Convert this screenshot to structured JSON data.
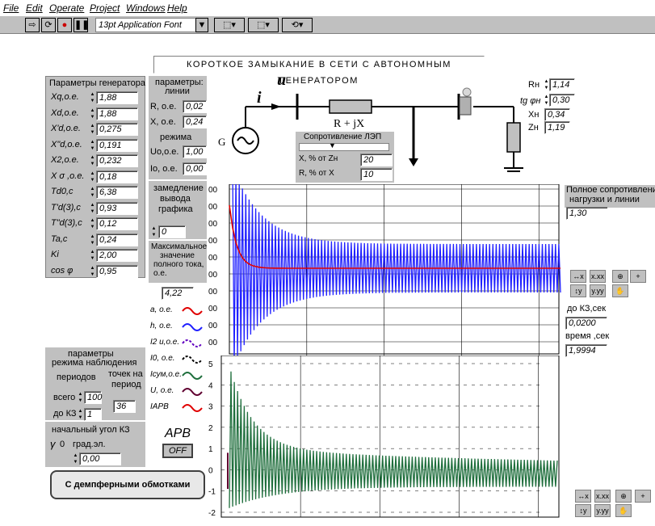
{
  "menu": [
    "File",
    "Edit",
    "Operate",
    "Project",
    "Windows",
    "Help"
  ],
  "toolbar": {
    "font": "13pt Application Font"
  },
  "title": "КОРОТКОЕ ЗАМЫКАНИЕ В СЕТИ С АВТОНОМНЫМ ГЕНЕРАТОРОМ",
  "gen": {
    "header": "Параметры генератора",
    "rows": [
      {
        "label": "Xq,о.е.",
        "value": "1,88"
      },
      {
        "label": "Xd,о.е.",
        "value": "1,88"
      },
      {
        "label": "X'd,о.е.",
        "value": "0,275"
      },
      {
        "label": "X\"d,о.е.",
        "value": "0,191"
      },
      {
        "label": "X2,о.е.",
        "value": "0,232"
      },
      {
        "label": "X σ ,о.е.",
        "value": "0,18"
      },
      {
        "label": "Td0,c",
        "value": "6,38"
      },
      {
        "label": "T'd(3),c",
        "value": "0,93"
      },
      {
        "label": "T\"d(3),c",
        "value": "0,12"
      },
      {
        "label": "Ta,c",
        "value": "0,24"
      },
      {
        "label": "Ki",
        "value": "2,00"
      },
      {
        "label": "cos φ",
        "value": "0,95"
      }
    ]
  },
  "line": {
    "header1": "параметры:",
    "header2": "линии",
    "R_label": "R, о.е.",
    "R": "0,02",
    "X_label": "X, о.е.",
    "X": "0,24",
    "mode_label": "режима",
    "U_label": "Uo,о.е.",
    "U": "1,00",
    "I_label": "Io, о.е.",
    "I": "0,00"
  },
  "slow": {
    "label1": "замедление",
    "label2": "вывода",
    "label3": "графика",
    "value": "0"
  },
  "maxcur": {
    "label1": "Максимальное",
    "label2": "значение",
    "label3": "полного тока,",
    "label4": "о.е.",
    "value": "4,22"
  },
  "legend": [
    {
      "label": "a, о.е.",
      "color": "#e00000"
    },
    {
      "label": "h, о.е.",
      "color": "#2020ff"
    },
    {
      "label": "I2 и,о.е.",
      "color": "#6000c0"
    },
    {
      "label": "I0, о.е.",
      "color": "#000000"
    },
    {
      "label": "Iсум,о.е.",
      "color": "#1e6e3c"
    },
    {
      "label": "U, о.е.",
      "color": "#600030"
    },
    {
      "label": "IАРВ",
      "color": "#e00000"
    }
  ],
  "obs": {
    "header1": "параметры",
    "header2": "режима наблюдения",
    "periods": "периодов",
    "total_label": "всего",
    "total": "100",
    "tokz_label": "до КЗ",
    "tokz": "1",
    "pts_label1": "точек на",
    "pts_label2": "период",
    "pts": "36"
  },
  "angle": {
    "label": "начальный угол КЗ",
    "gamma": "γ",
    "gamma_val": "0",
    "unit": "град.эл.",
    "value": "0,00"
  },
  "arv": {
    "label": "АРВ",
    "state": "OFF"
  },
  "damper_button": "С демпферными обмотками",
  "scheme": {
    "u_label": "u",
    "i_label": "i",
    "g_label": "G",
    "rjx_label": "R + jX",
    "slider_label": "Сопротивление ЛЭП",
    "xpct_label": "X, % от Zн",
    "xpct": "20",
    "rpct_label": "R, % от X",
    "rpct": "10"
  },
  "load": {
    "Rn_label": "Rн",
    "Rn": "1,14",
    "tg_label": "tg φн",
    "tg": "0,30",
    "Xn_label": "Xн",
    "Xn": "0,34",
    "Zn_label": "Zн",
    "Zn": "1,19"
  },
  "right": {
    "fullz_label1": "Полное сопротивление",
    "fullz_label2": "нагрузки и линии",
    "fullz": "1,30",
    "tokz_label": "до КЗ,сек",
    "tokz": "0,0200",
    "time_label": "время ,сек",
    "time": "1,9994"
  },
  "chart_data": [
    {
      "type": "line",
      "title": "",
      "series": [
        {
          "name": "h, о.е.",
          "color": "#2020ff"
        },
        {
          "name": "a, о.е.",
          "color": "#e00000"
        }
      ],
      "y_tick_labels": [
        "00",
        "00",
        "00",
        "00",
        "00",
        "00",
        "00",
        "00",
        "00",
        "00"
      ]
    },
    {
      "type": "line",
      "title": "",
      "series": [
        {
          "name": "Iсум,о.е.",
          "color": "#1e6e3c"
        },
        {
          "name": "U, о.е.",
          "color": "#600030"
        }
      ],
      "y_tick_labels": [
        "5",
        "4",
        "3",
        "2",
        "1",
        "0",
        "-1",
        "-2"
      ],
      "ylim": [
        -2,
        5
      ]
    }
  ]
}
